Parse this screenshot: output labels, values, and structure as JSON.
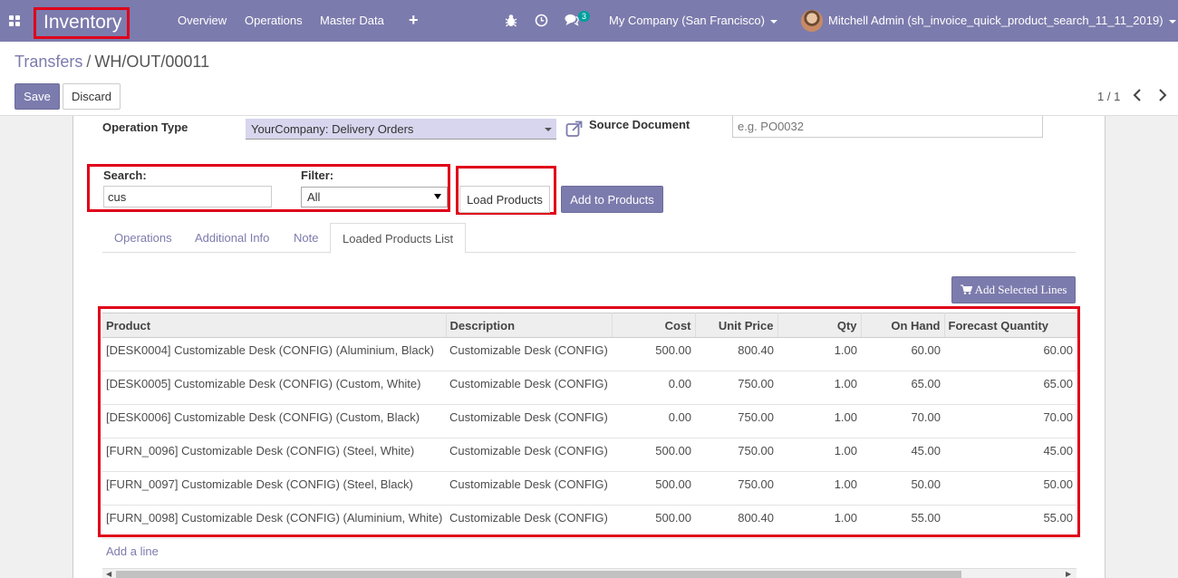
{
  "navbar": {
    "app_name": "Inventory",
    "menu": [
      "Overview",
      "Operations",
      "Master Data"
    ],
    "plus": "+",
    "chat_count": "3",
    "company": "My Company (San Francisco)",
    "user": "Mitchell Admin (sh_invoice_quick_product_search_11_11_2019)"
  },
  "breadcrumb": {
    "parent": "Transfers",
    "separator": "/",
    "current": "WH/OUT/00011"
  },
  "buttons": {
    "save": "Save",
    "discard": "Discard",
    "load_products": "Load Products",
    "add_to_products": "Add to Products",
    "add_selected_lines": "Add Selected Lines"
  },
  "pager": {
    "value": "1 / 1"
  },
  "form": {
    "operation_type_label": "Operation Type",
    "operation_type_value": "YourCompany: Delivery Orders",
    "source_document_label": "Source Document",
    "source_document_placeholder": "e.g. PO0032",
    "search_label": "Search:",
    "search_value": "cus",
    "filter_label": "Filter:",
    "filter_value": "All"
  },
  "tabs": [
    "Operations",
    "Additional Info",
    "Note",
    "Loaded Products List"
  ],
  "table": {
    "headers": [
      "Product",
      "Description",
      "Cost",
      "Unit Price",
      "Qty",
      "On Hand",
      "Forecast Quantity"
    ],
    "rows": [
      [
        "[DESK0004] Customizable Desk (CONFIG) (Aluminium, Black)",
        "Customizable Desk (CONFIG)",
        "500.00",
        "800.40",
        "1.00",
        "60.00",
        "60.00"
      ],
      [
        "[DESK0005] Customizable Desk (CONFIG) (Custom, White)",
        "Customizable Desk (CONFIG)",
        "0.00",
        "750.00",
        "1.00",
        "65.00",
        "65.00"
      ],
      [
        "[DESK0006] Customizable Desk (CONFIG) (Custom, Black)",
        "Customizable Desk (CONFIG)",
        "0.00",
        "750.00",
        "1.00",
        "70.00",
        "70.00"
      ],
      [
        "[FURN_0096] Customizable Desk (CONFIG) (Steel, White)",
        "Customizable Desk (CONFIG)",
        "500.00",
        "750.00",
        "1.00",
        "45.00",
        "45.00"
      ],
      [
        "[FURN_0097] Customizable Desk (CONFIG) (Steel, Black)",
        "Customizable Desk (CONFIG)",
        "500.00",
        "750.00",
        "1.00",
        "50.00",
        "50.00"
      ],
      [
        "[FURN_0098] Customizable Desk (CONFIG) (Aluminium, White)",
        "Customizable Desk (CONFIG)",
        "500.00",
        "800.40",
        "1.00",
        "55.00",
        "55.00"
      ]
    ],
    "add_line": "Add a line"
  },
  "icons": {
    "apps": "apps-grid-icon",
    "debug": "bug-icon",
    "activity": "clock-icon",
    "messages": "chat-icon",
    "external": "external-link-icon",
    "cart": "cart-icon"
  },
  "colors": {
    "primary": "#7c7bad",
    "highlight": "#e0001a",
    "badge": "#00a09d"
  }
}
